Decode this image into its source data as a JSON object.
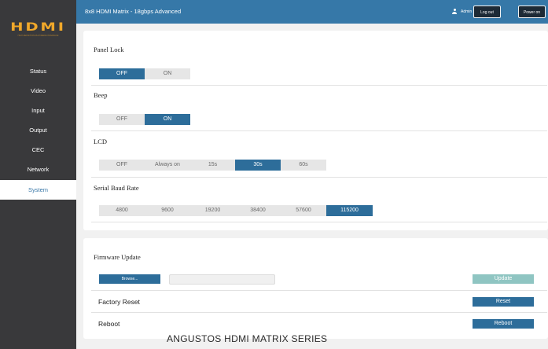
{
  "header": {
    "title": "8x8 HDMI Matrix - 18gbps Advanced",
    "user": "Admin",
    "logout_label": "Log out",
    "power_label": "Power on"
  },
  "sidebar": {
    "logo": "HDMI",
    "logo_sub": "HIGH-DEFINITION MULTIMEDIA INTERFACE",
    "items": [
      {
        "label": "Status"
      },
      {
        "label": "Video"
      },
      {
        "label": "Input"
      },
      {
        "label": "Output"
      },
      {
        "label": "CEC"
      },
      {
        "label": "Network"
      },
      {
        "label": "System",
        "active": true
      }
    ]
  },
  "system": {
    "panel_lock": {
      "label": "Panel Lock",
      "options": [
        "OFF",
        "ON"
      ],
      "selected": "OFF"
    },
    "beep": {
      "label": "Beep",
      "options": [
        "OFF",
        "ON"
      ],
      "selected": "ON"
    },
    "lcd": {
      "label": "LCD",
      "options": [
        "OFF",
        "Always on",
        "15s",
        "30s",
        "60s"
      ],
      "selected": "30s"
    },
    "baud": {
      "label": "Serial Baud Rate",
      "options": [
        "4800",
        "9600",
        "19200",
        "38400",
        "57600",
        "115200"
      ],
      "selected": "115200"
    }
  },
  "maintenance": {
    "firmware_label": "Firmware Update",
    "browse_label": "Browse...",
    "update_label": "Update",
    "factory_reset_label": "Factory Reset",
    "reset_label": "Reset",
    "reboot_label": "Reboot",
    "reboot_button": "Reboot"
  },
  "footer": "ANGUSTOS HDMI MATRIX SERIES",
  "colors": {
    "accent": "#2d6d9a",
    "topbar": "#3678a8",
    "sidebar": "#39393b",
    "logo": "#f0a82a",
    "update_button": "#8fc5c2"
  }
}
